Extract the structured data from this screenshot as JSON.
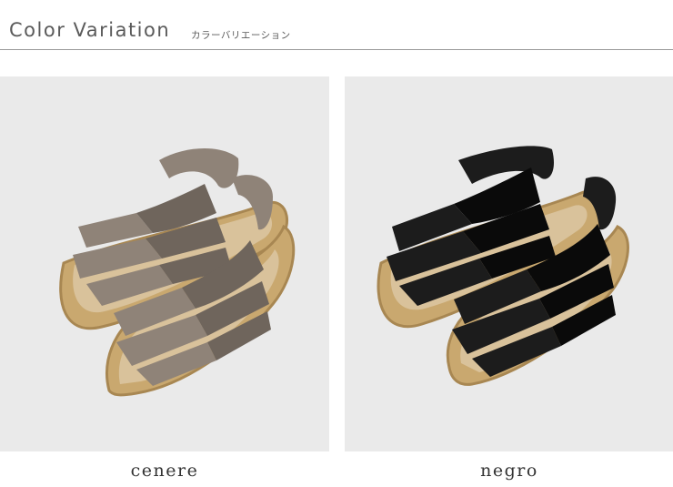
{
  "header": {
    "title": "Color Variation",
    "subtitle": "カラーバリエーション"
  },
  "variants": [
    {
      "label": "cenere",
      "upper_color": "#8f8378",
      "upper_shadow": "#6f655c"
    },
    {
      "label": "negro",
      "upper_color": "#1c1c1c",
      "upper_shadow": "#0a0a0a"
    }
  ],
  "colors": {
    "panel_bg": "#eaeaea",
    "jute": "#c9a86f",
    "jute_dark": "#a88752",
    "insole": "#d9c29b"
  }
}
